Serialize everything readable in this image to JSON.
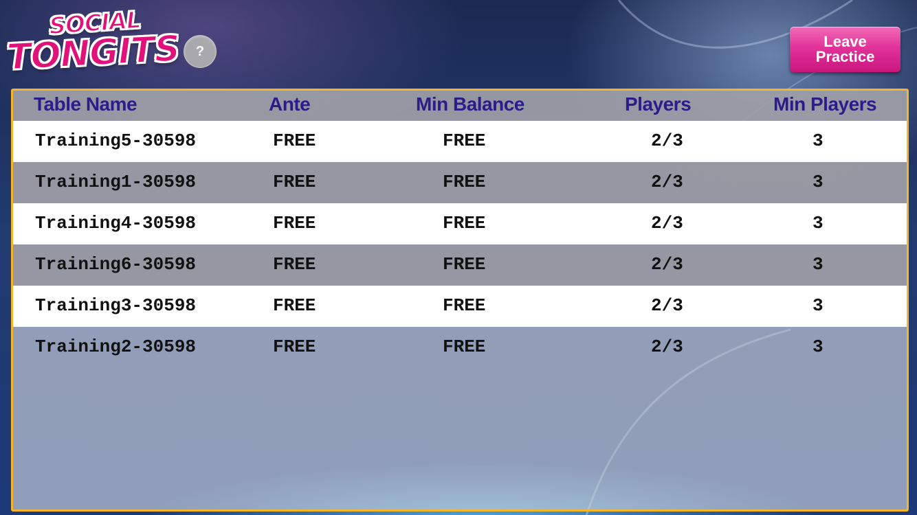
{
  "logo": {
    "line1": "SOCIAL",
    "line2": "TONGITS"
  },
  "help": {
    "label": "?"
  },
  "leave_button": {
    "line1": "Leave",
    "line2": "Practice"
  },
  "table": {
    "headers": [
      "Table Name",
      "Ante",
      "Min Balance",
      "Players",
      "Min Players"
    ],
    "rows": [
      {
        "name": "Training5-30598",
        "ante": "FREE",
        "min_balance": "FREE",
        "players": "2/3",
        "min_players": "3"
      },
      {
        "name": "Training1-30598",
        "ante": "FREE",
        "min_balance": "FREE",
        "players": "2/3",
        "min_players": "3"
      },
      {
        "name": "Training4-30598",
        "ante": "FREE",
        "min_balance": "FREE",
        "players": "2/3",
        "min_players": "3"
      },
      {
        "name": "Training6-30598",
        "ante": "FREE",
        "min_balance": "FREE",
        "players": "2/3",
        "min_players": "3"
      },
      {
        "name": "Training3-30598",
        "ante": "FREE",
        "min_balance": "FREE",
        "players": "2/3",
        "min_players": "3"
      },
      {
        "name": "Training2-30598",
        "ante": "FREE",
        "min_balance": "FREE",
        "players": "2/3",
        "min_players": "3"
      }
    ]
  },
  "colors": {
    "header_text": "#2d1b8c",
    "panel_border": "#f4b52a",
    "leave_button": "#e2339a",
    "logo_pink": "#e0127a"
  }
}
